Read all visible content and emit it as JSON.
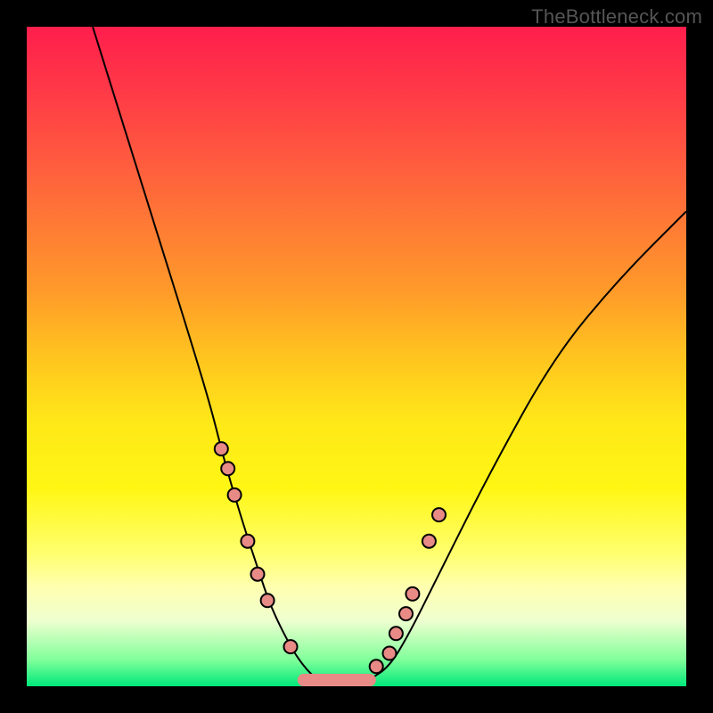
{
  "watermark": "TheBottleneck.com",
  "chart_data": {
    "type": "line",
    "title": "",
    "xlabel": "",
    "ylabel": "",
    "xlim": [
      0,
      100
    ],
    "ylim": [
      0,
      100
    ],
    "curve": {
      "x": [
        10,
        15,
        20,
        25,
        28,
        30,
        33,
        35,
        37,
        40,
        42,
        44,
        46,
        50,
        52,
        55,
        58,
        62,
        70,
        80,
        90,
        100
      ],
      "y": [
        100,
        84,
        68,
        52,
        42,
        34,
        24,
        18,
        12,
        6,
        3,
        1,
        0,
        0,
        1,
        3,
        8,
        16,
        32,
        50,
        62,
        72
      ]
    },
    "left_dots": {
      "x": [
        29.5,
        30.5,
        31.5,
        33.5,
        35.0,
        36.5,
        40.0
      ],
      "y": [
        36,
        33,
        29,
        22,
        17,
        13,
        6
      ]
    },
    "right_dots": {
      "x": [
        53.0,
        55.0,
        56.0,
        57.5,
        58.5,
        61.0,
        62.5
      ],
      "y": [
        3,
        5,
        8,
        11,
        14,
        22,
        26
      ]
    },
    "flat_segment": {
      "x0": 42,
      "x1": 52,
      "y": 0
    },
    "colors": {
      "dot_fill": "#e88a85",
      "curve_stroke": "#000000"
    }
  }
}
